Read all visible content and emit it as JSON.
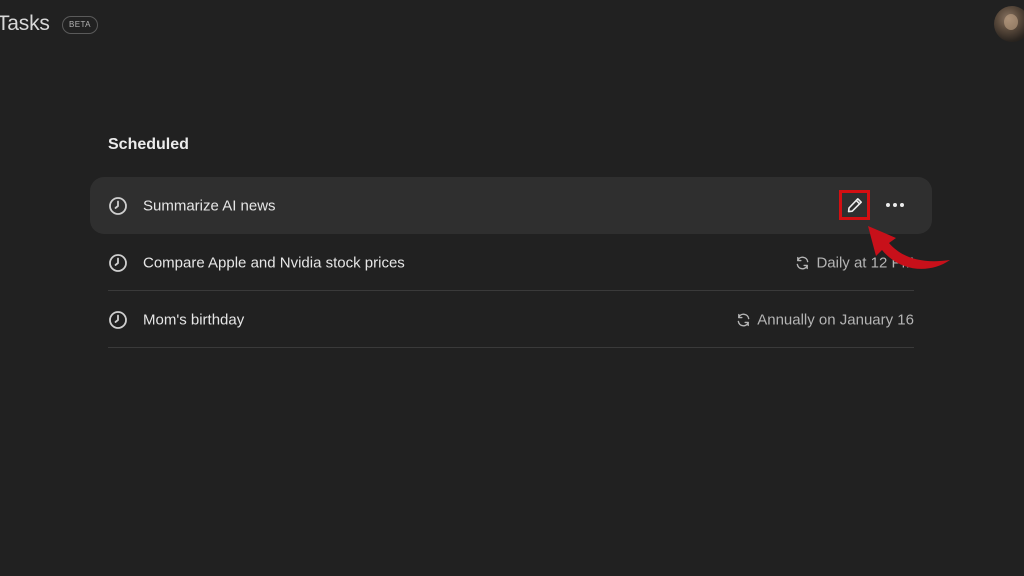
{
  "header": {
    "title": "Tasks",
    "badge": "BETA"
  },
  "section": {
    "title": "Scheduled"
  },
  "tasks": [
    {
      "label": "Summarize AI news",
      "schedule": ""
    },
    {
      "label": "Compare Apple and Nvidia stock prices",
      "schedule": "Daily at 12 PM"
    },
    {
      "label": "Mom's birthday",
      "schedule": "Annually on January 16"
    }
  ],
  "icons": {
    "task": "clock-icon",
    "schedule": "repeat-icon",
    "edit": "pencil-icon",
    "more": "more-horizontal-icon"
  },
  "colors": {
    "background": "#212121",
    "row_hover": "#2f2f2f",
    "highlight": "#d40f12"
  }
}
